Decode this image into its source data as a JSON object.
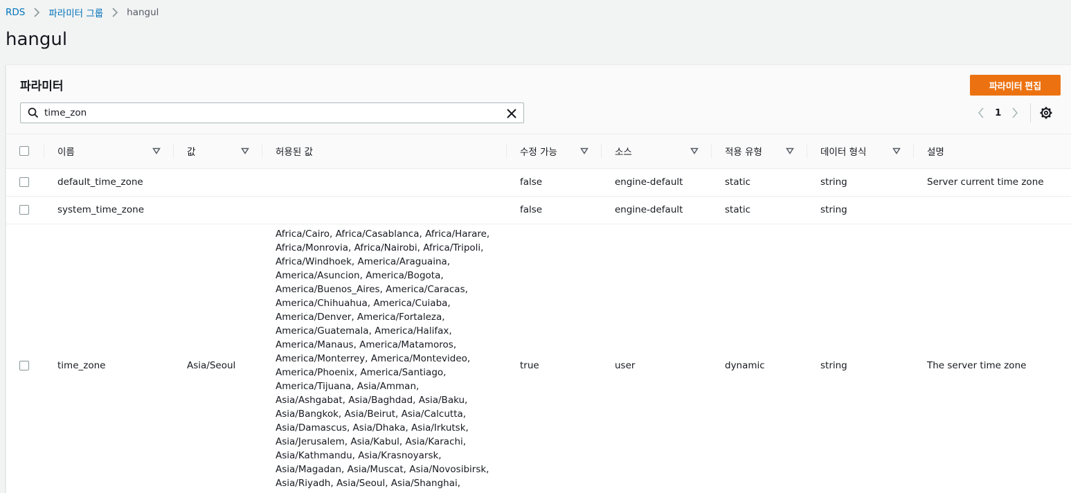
{
  "breadcrumb": {
    "root": "RDS",
    "group": "파라미터 그룹",
    "current": "hangul"
  },
  "page_title": "hangul",
  "panel": {
    "title": "파라미터",
    "edit_button": "파라미터 편집",
    "search": {
      "value": "time_zon",
      "placeholder": ""
    },
    "pagination": {
      "current_page": "1"
    }
  },
  "table": {
    "headers": {
      "name": "이름",
      "value": "값",
      "allowed": "허용된 값",
      "modifiable": "수정 가능",
      "source": "소스",
      "apply_type": "적용 유형",
      "data_type": "데이터 형식",
      "description": "설명"
    },
    "rows": [
      {
        "name": "default_time_zone",
        "value": "",
        "allowed": "",
        "modifiable": "false",
        "source": "engine-default",
        "apply_type": "static",
        "data_type": "string",
        "description": "Server current time zone"
      },
      {
        "name": "system_time_zone",
        "value": "",
        "allowed": "",
        "modifiable": "false",
        "source": "engine-default",
        "apply_type": "static",
        "data_type": "string",
        "description": ""
      },
      {
        "name": "time_zone",
        "value": "Asia/Seoul",
        "allowed": "Africa/Cairo, Africa/Casablanca, Africa/Harare, Africa/Monrovia, Africa/Nairobi, Africa/Tripoli, Africa/Windhoek, America/Araguaina, America/Asuncion, America/Bogota, America/Buenos_Aires, America/Caracas, America/Chihuahua, America/Cuiaba, America/Denver, America/Fortaleza, America/Guatemala, America/Halifax, America/Manaus, America/Matamoros, America/Monterrey, America/Montevideo, America/Phoenix, America/Santiago, America/Tijuana, Asia/Amman, Asia/Ashgabat, Asia/Baghdad, Asia/Baku, Asia/Bangkok, Asia/Beirut, Asia/Calcutta, Asia/Damascus, Asia/Dhaka, Asia/Irkutsk, Asia/Jerusalem, Asia/Kabul, Asia/Karachi, Asia/Kathmandu, Asia/Krasnoyarsk, Asia/Magadan, Asia/Muscat, Asia/Novosibirsk, Asia/Riyadh, Asia/Seoul, Asia/Shanghai, Asia/Singapore, Asia/Taipei,",
        "modifiable": "true",
        "source": "user",
        "apply_type": "dynamic",
        "data_type": "string",
        "description": "The server time zone"
      }
    ]
  }
}
